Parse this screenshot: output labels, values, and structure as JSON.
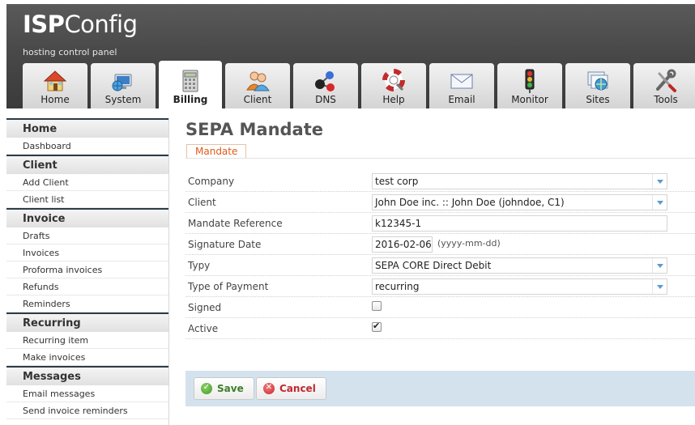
{
  "app": {
    "logo_bold": "ISP",
    "logo_light": "Config",
    "tagline": "hosting control panel"
  },
  "tabs": [
    {
      "label": "Home",
      "icon": "house-icon"
    },
    {
      "label": "System",
      "icon": "computer-globe-icon"
    },
    {
      "label": "Billing",
      "icon": "calculator-icon",
      "active": true
    },
    {
      "label": "Client",
      "icon": "users-icon"
    },
    {
      "label": "DNS",
      "icon": "dns-network-icon"
    },
    {
      "label": "Help",
      "icon": "lifebuoy-icon"
    },
    {
      "label": "Email",
      "icon": "envelope-icon"
    },
    {
      "label": "Monitor",
      "icon": "traffic-light-icon"
    },
    {
      "label": "Sites",
      "icon": "sites-globe-icon"
    },
    {
      "label": "Tools",
      "icon": "tools-icon"
    }
  ],
  "sidebar": {
    "home": {
      "title": "Home",
      "items": [
        "Dashboard"
      ]
    },
    "client": {
      "title": "Client",
      "items": [
        "Add Client",
        "Client list"
      ]
    },
    "invoice": {
      "title": "Invoice",
      "items": [
        "Drafts",
        "Invoices",
        "Proforma invoices",
        "Refunds",
        "Reminders"
      ]
    },
    "recurring": {
      "title": "Recurring",
      "items": [
        "Recurring item",
        "Make invoices"
      ]
    },
    "messages": {
      "title": "Messages",
      "items": [
        "Email messages",
        "Send invoice reminders"
      ]
    }
  },
  "page": {
    "title": "SEPA Mandate",
    "subtab": "Mandate"
  },
  "form": {
    "company": {
      "label": "Company",
      "value": "test corp"
    },
    "client": {
      "label": "Client",
      "value": "John Doe inc. :: John Doe (johndoe, C1)"
    },
    "mandate_reference": {
      "label": "Mandate Reference",
      "value": "k12345-1"
    },
    "signature_date": {
      "label": "Signature Date",
      "value": "2016-02-06",
      "hint": "(yyyy-mm-dd)"
    },
    "typy": {
      "label": "Typy",
      "value": "SEPA CORE Direct Debit"
    },
    "type_of_payment": {
      "label": "Type of Payment",
      "value": "recurring"
    },
    "signed": {
      "label": "Signed",
      "checked": false
    },
    "active": {
      "label": "Active",
      "checked": true
    }
  },
  "buttons": {
    "save": "Save",
    "cancel": "Cancel"
  },
  "colors": {
    "accent_orange": "#e05b1a",
    "save_green": "#3f7d2a",
    "cancel_red": "#c0282d",
    "button_bar": "#d4e2ee"
  }
}
